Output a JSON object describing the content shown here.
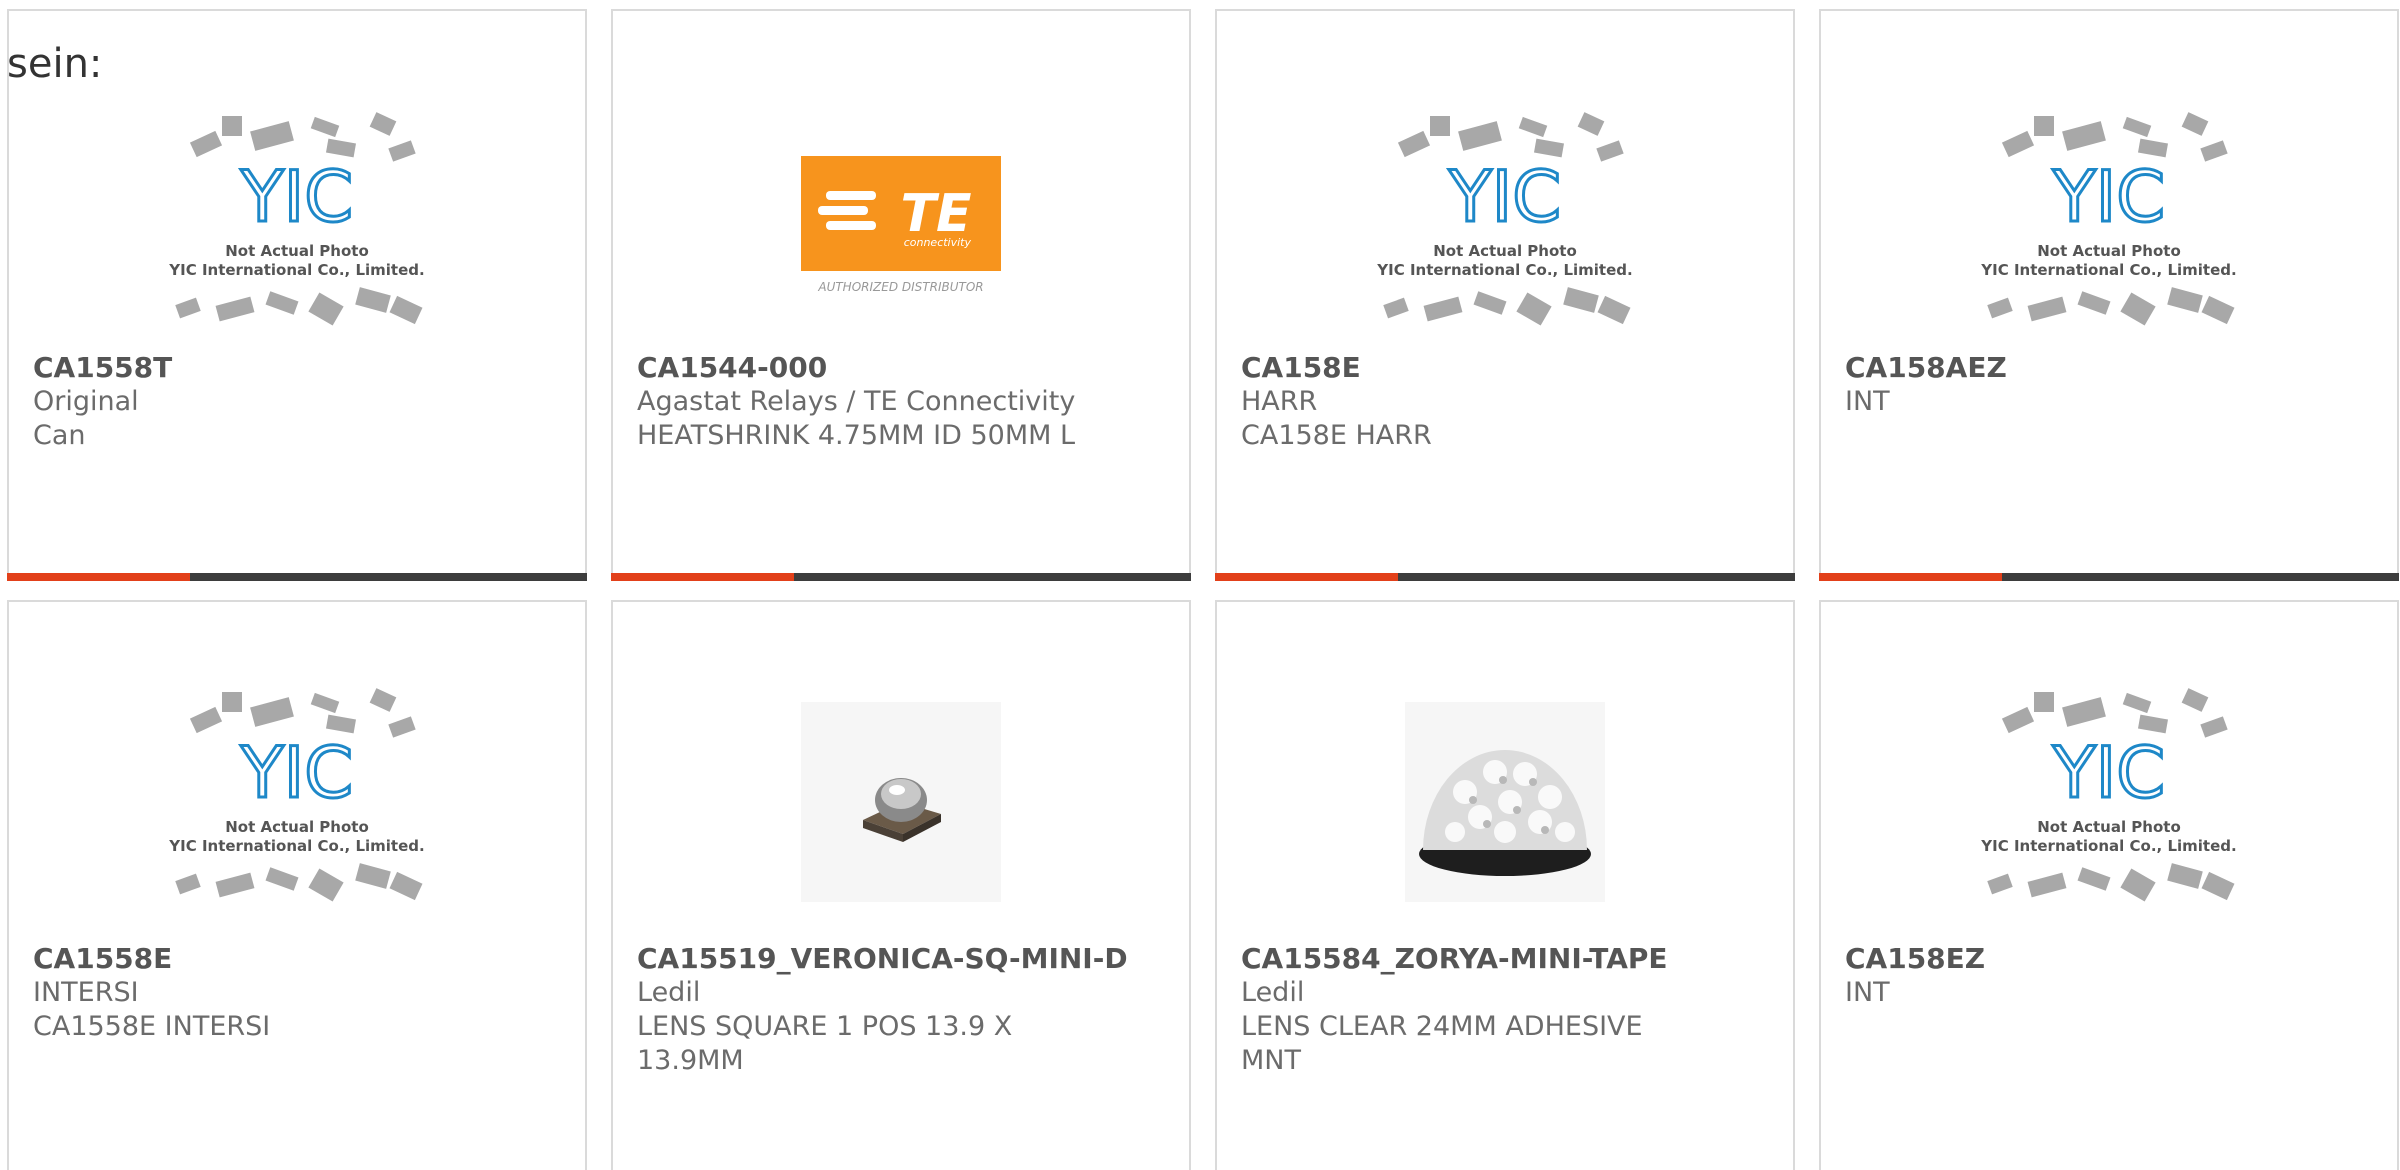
{
  "heading": "sein:",
  "placeholder": {
    "line1": "Not Actual Photo",
    "line2": "YIC International Co., Limited."
  },
  "te_logo": {
    "brand": "TE",
    "sub": "connectivity",
    "tagline": "AUTHORIZED DISTRIBUTOR"
  },
  "colors": {
    "accent": "#e2401a",
    "bar": "#3d3d3d",
    "te_orange": "#f7941d",
    "yic_blue": "#1e88c8"
  },
  "products": [
    {
      "pn": "CA1558T",
      "lines": [
        "Original",
        "Can"
      ],
      "image": "yic-placeholder"
    },
    {
      "pn": "CA1544-000",
      "lines": [
        "Agastat Relays / TE Connectivity",
        "HEATSHRINK 4.75MM ID 50MM L"
      ],
      "image": "te-logo"
    },
    {
      "pn": "CA158E",
      "lines": [
        "HARR",
        "CA158E HARR"
      ],
      "image": "yic-placeholder"
    },
    {
      "pn": "CA158AEZ",
      "lines": [
        "INT"
      ],
      "image": "yic-placeholder"
    },
    {
      "pn": "CA1558E",
      "lines": [
        "INTERSI",
        "CA1558E INTERSI"
      ],
      "image": "yic-placeholder"
    },
    {
      "pn": "CA15519_VERONICA-SQ-MINI-D",
      "lines": [
        "Ledil",
        "LENS SQUARE 1 POS 13.9 X",
        "13.9MM"
      ],
      "image": "lens-square"
    },
    {
      "pn": "CA15584_ZORYA-MINI-TAPE",
      "lines": [
        "Ledil",
        "LENS CLEAR 24MM ADHESIVE",
        "MNT"
      ],
      "image": "lens-dome"
    },
    {
      "pn": "CA158EZ",
      "lines": [
        "INT"
      ],
      "image": "yic-placeholder"
    }
  ]
}
